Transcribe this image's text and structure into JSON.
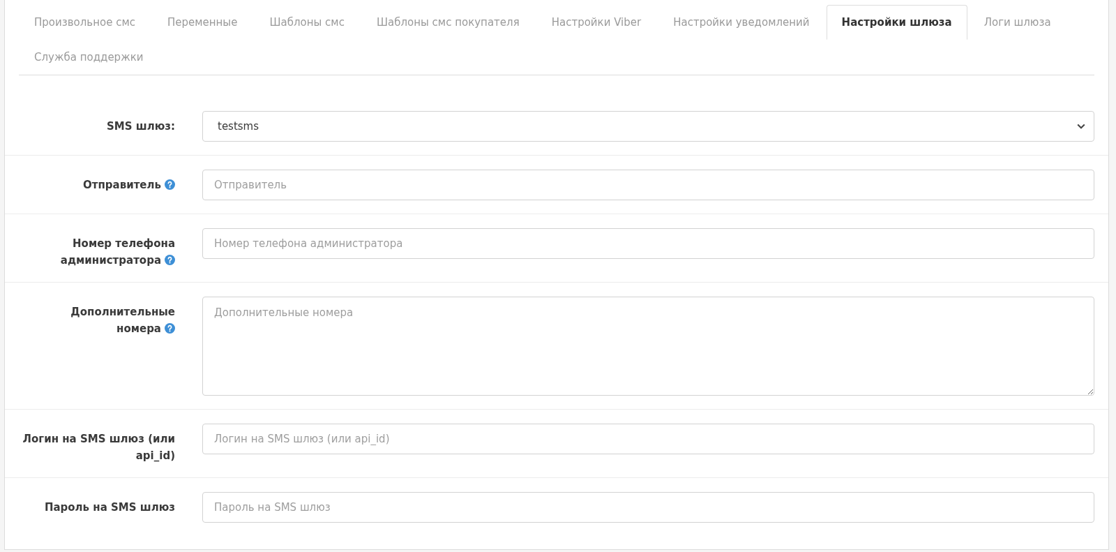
{
  "tabs": [
    {
      "label": "Произвольное смс",
      "selected": false
    },
    {
      "label": "Переменные",
      "selected": false
    },
    {
      "label": "Шаблоны смс",
      "selected": false
    },
    {
      "label": "Шаблоны смс покупателя",
      "selected": false
    },
    {
      "label": "Настройки Viber",
      "selected": false
    },
    {
      "label": "Настройки уведомлений",
      "selected": false
    },
    {
      "label": "Настройки шлюза",
      "selected": true
    },
    {
      "label": "Логи шлюза",
      "selected": false
    },
    {
      "label": "Служба поддержки",
      "selected": false
    }
  ],
  "form": {
    "fields": [
      {
        "kind": "select",
        "label": "SMS шлюз:",
        "help": false,
        "value": "testsms"
      },
      {
        "kind": "input",
        "label": "Отправитель",
        "help": true,
        "placeholder": "Отправитель"
      },
      {
        "kind": "input",
        "label": "Номер телефона администратора",
        "help": true,
        "placeholder": "Номер телефона администратора"
      },
      {
        "kind": "textarea",
        "label": "Дополнительные номера",
        "help": true,
        "placeholder": "Дополнительные номера"
      },
      {
        "kind": "input",
        "label": "Логин на SMS шлюз (или api_id)",
        "help": false,
        "placeholder": "Логин на SMS шлюз (или api_id)"
      },
      {
        "kind": "input",
        "label": "Пароль на SMS шлюз",
        "help": false,
        "placeholder": "Пароль на SMS шлюз"
      }
    ]
  }
}
